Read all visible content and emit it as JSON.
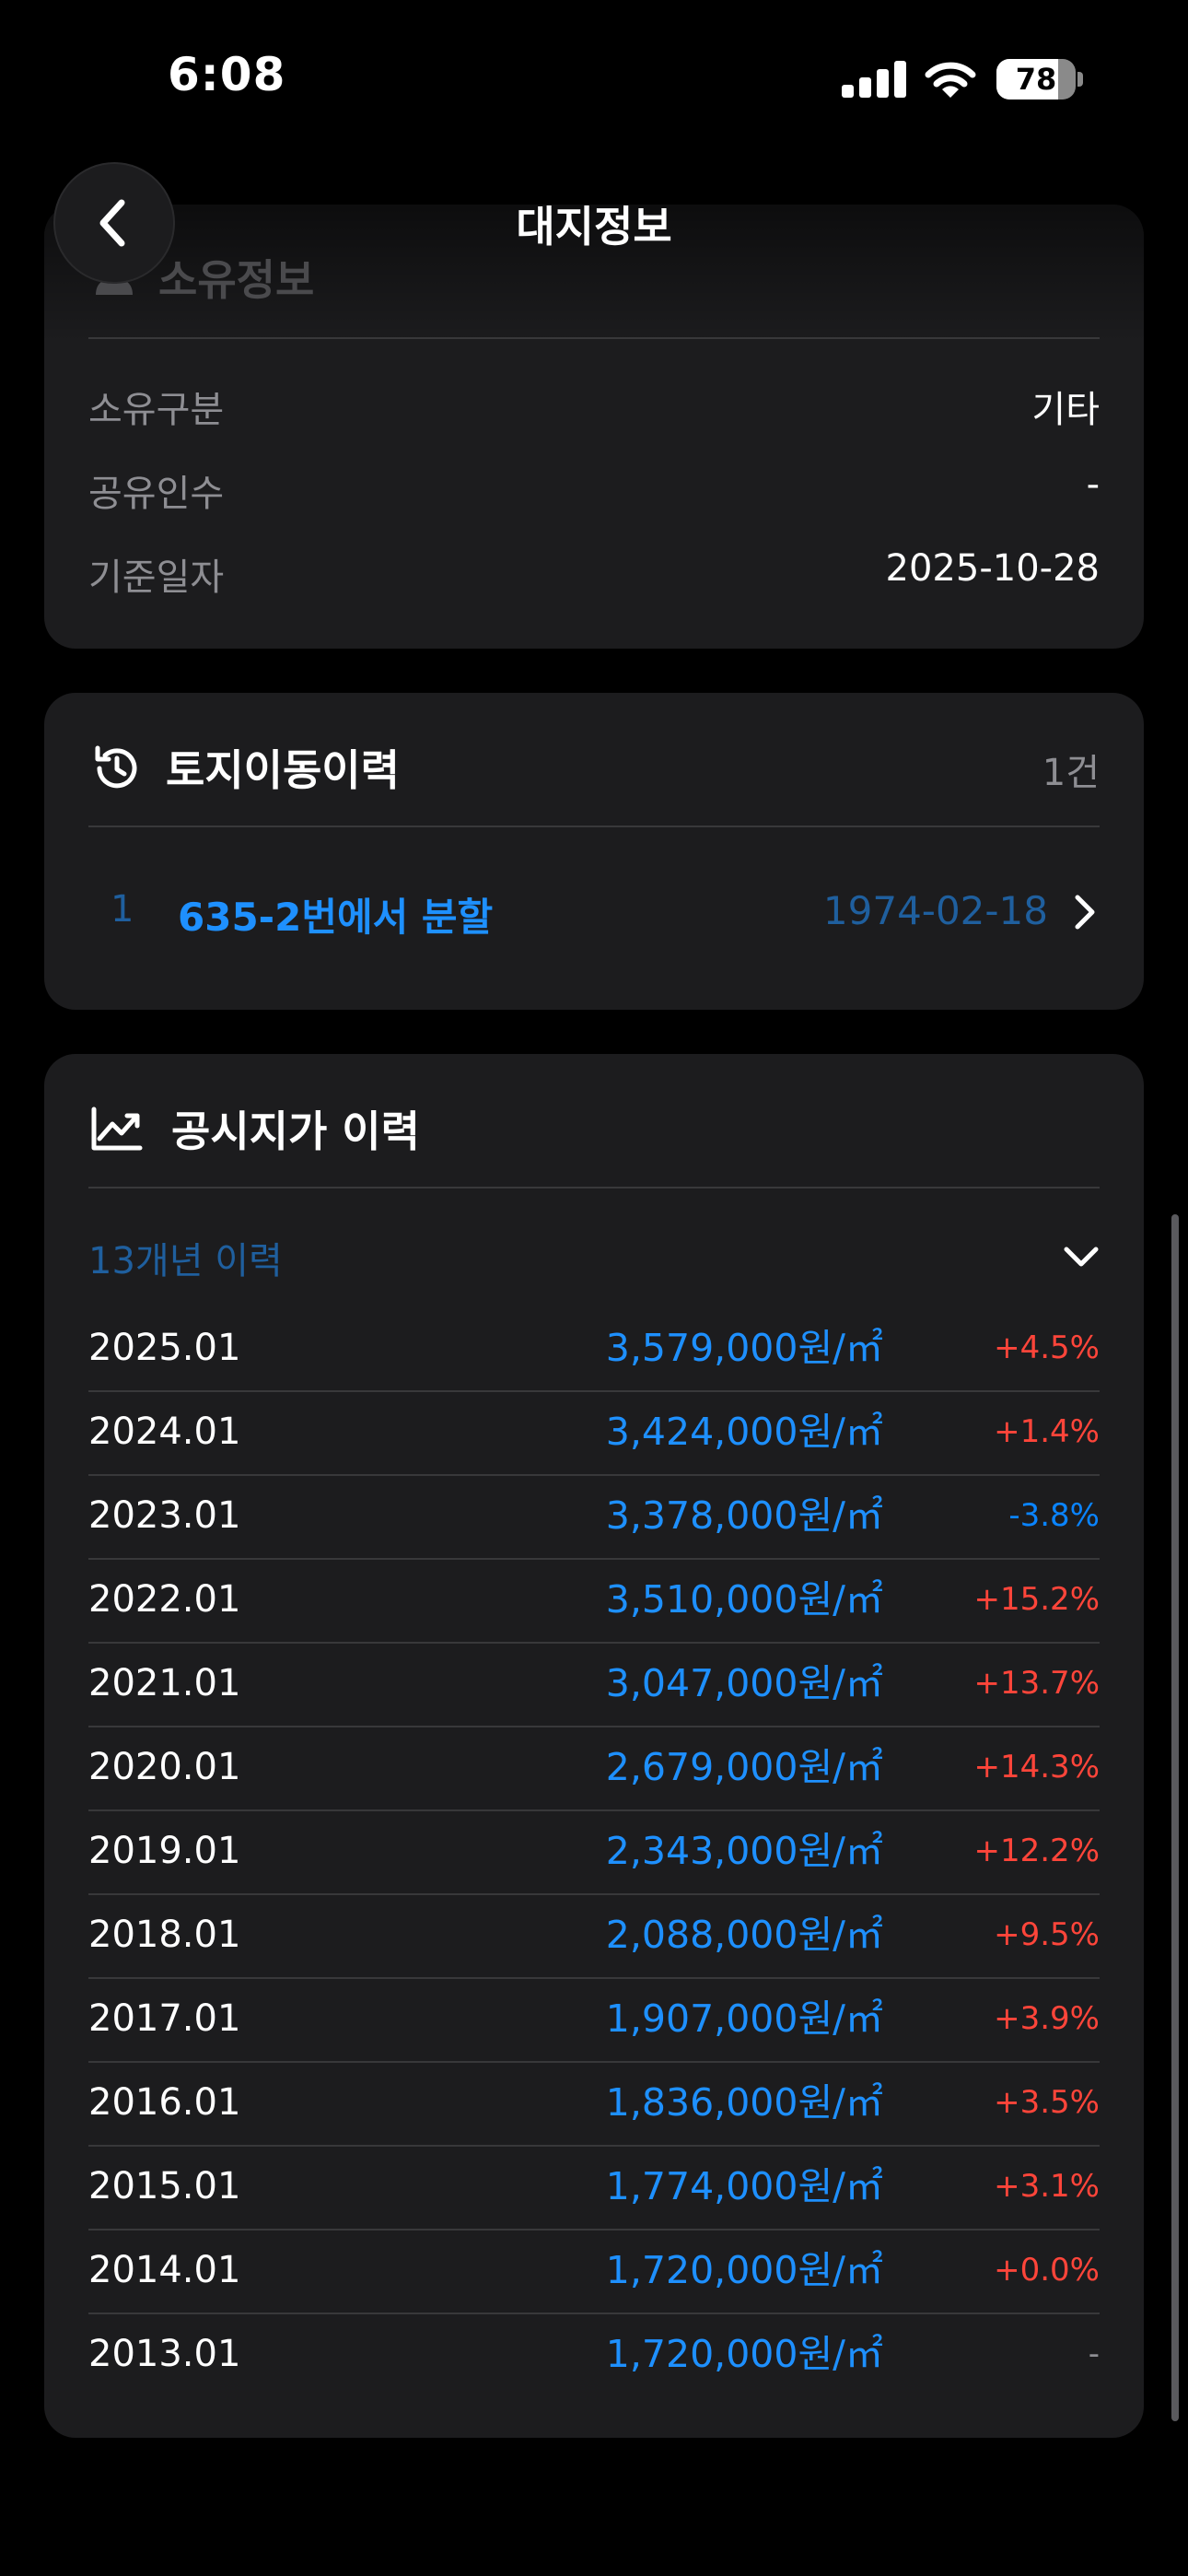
{
  "status_bar": {
    "time": "6:08",
    "battery": "78",
    "battery_level": 0.78
  },
  "nav": {
    "title": "대지정보"
  },
  "owner_card": {
    "header": "소유정보",
    "rows": [
      {
        "label": "소유구분",
        "value": "기타"
      },
      {
        "label": "공유인수",
        "value": "-"
      },
      {
        "label": "기준일자",
        "value": "2025-10-28"
      }
    ]
  },
  "move_card": {
    "title": "토지이동이력",
    "count": "1건",
    "items": [
      {
        "index": "1",
        "label": "635-2번에서 분할",
        "date": "1974-02-18"
      }
    ]
  },
  "price_card": {
    "title": "공시지가 이력",
    "toggle_label": "13개년 이력",
    "rows": [
      {
        "year": "2025.01",
        "price": "3,579,000원/㎡",
        "change": "+4.5%"
      },
      {
        "year": "2024.01",
        "price": "3,424,000원/㎡",
        "change": "+1.4%"
      },
      {
        "year": "2023.01",
        "price": "3,378,000원/㎡",
        "change": "-3.8%"
      },
      {
        "year": "2022.01",
        "price": "3,510,000원/㎡",
        "change": "+15.2%"
      },
      {
        "year": "2021.01",
        "price": "3,047,000원/㎡",
        "change": "+13.7%"
      },
      {
        "year": "2020.01",
        "price": "2,679,000원/㎡",
        "change": "+14.3%"
      },
      {
        "year": "2019.01",
        "price": "2,343,000원/㎡",
        "change": "+12.2%"
      },
      {
        "year": "2018.01",
        "price": "2,088,000원/㎡",
        "change": "+9.5%"
      },
      {
        "year": "2017.01",
        "price": "1,907,000원/㎡",
        "change": "+3.9%"
      },
      {
        "year": "2016.01",
        "price": "1,836,000원/㎡",
        "change": "+3.5%"
      },
      {
        "year": "2015.01",
        "price": "1,774,000원/㎡",
        "change": "+3.1%"
      },
      {
        "year": "2014.01",
        "price": "1,720,000원/㎡",
        "change": "+0.0%"
      },
      {
        "year": "2013.01",
        "price": "1,720,000원/㎡",
        "change": "-"
      }
    ]
  },
  "colors": {
    "increase": "#ff453a",
    "decrease": "#0a84ff",
    "neutral": "#8e8e93",
    "link": "#1e90ff"
  }
}
